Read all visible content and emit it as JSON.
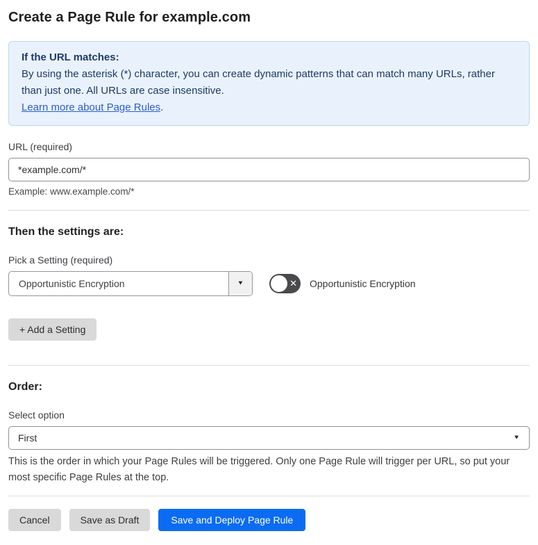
{
  "page": {
    "title": "Create a Page Rule for example.com"
  },
  "info_box": {
    "heading": "If the URL matches:",
    "body": "By using the asterisk (*) character, you can create dynamic patterns that can match many URLs, rather than just one. All URLs are case insensitive.",
    "link_label": "Learn more about Page Rules",
    "link_suffix": "."
  },
  "url_field": {
    "label": "URL (required)",
    "value": "*example.com/*",
    "helper": "Example: www.example.com/*"
  },
  "settings_section": {
    "heading": "Then the settings are:",
    "picker_label": "Pick a Setting (required)",
    "picker_value": "Opportunistic Encryption",
    "toggle_label": "Opportunistic Encryption",
    "toggle_state": "off",
    "add_button_label": "+ Add a Setting"
  },
  "order_section": {
    "heading": "Order:",
    "select_label": "Select option",
    "select_value": "First",
    "helper": "This is the order in which your Page Rules will be triggered. Only one Page Rule will trigger per URL, so put your most specific Page Rules at the top."
  },
  "footer": {
    "cancel_label": "Cancel",
    "save_draft_label": "Save as Draft",
    "save_deploy_label": "Save and Deploy Page Rule"
  },
  "icons": {
    "dropdown_arrow": "▼",
    "select_arrow": "▼",
    "toggle_x": "✕"
  },
  "colors": {
    "accent_blue": "#0b6cf2",
    "info_background": "#e9f2fc",
    "info_border": "#bcd6f1",
    "info_text": "#1e3a66",
    "link_blue": "#2c5ec9",
    "toggle_off_background": "#4a4a4c",
    "gray_button_background": "#d9d9d9"
  }
}
